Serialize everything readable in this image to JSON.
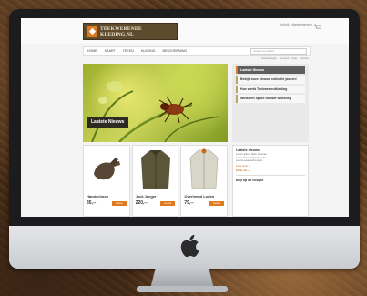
{
  "site": {
    "logo_text_line1": "TEEKWERENDE",
    "logo_text_line2": "KLEDING.NL",
    "header_right": "info@ · klantenservice",
    "nav": [
      "HOME",
      "KAART",
      "TEKEN",
      "KLEDING",
      "BESCHERMING"
    ],
    "search_placeholder": "zoeken op artikel",
    "subbar": [
      "winkelwagen",
      "account",
      "help",
      "contact"
    ],
    "hero_caption": "Laatste Nieuws",
    "side_menu": [
      "Laatste Nieuws",
      "Bekijk onze nieuwe collectie jassen!",
      "Hoe werkt Teekwerendkleding",
      "Winkelen op de nieuwe webshop"
    ],
    "products": [
      {
        "name": "Handschoen",
        "price": "35,--",
        "buy": "bestel"
      },
      {
        "name": "Jack Jaeger",
        "price": "220,--",
        "buy": "bestel"
      },
      {
        "name": "Overhemd Loden",
        "price": "79,--",
        "buy": "bestel"
      }
    ],
    "right_panel": {
      "title": "Laatste nieuws",
      "lines": [
        "Lorem ipsum dolor sit amet",
        "consectetur adipiscing elit",
        "sed do eiusmod tempor"
      ],
      "link1": "Lees meer »",
      "link2": "Bekijk alle »",
      "title2": "Blijf op de hoogte"
    },
    "colors": {
      "accent": "#e07a1e",
      "logo_bg": "#5e4a2c"
    }
  }
}
